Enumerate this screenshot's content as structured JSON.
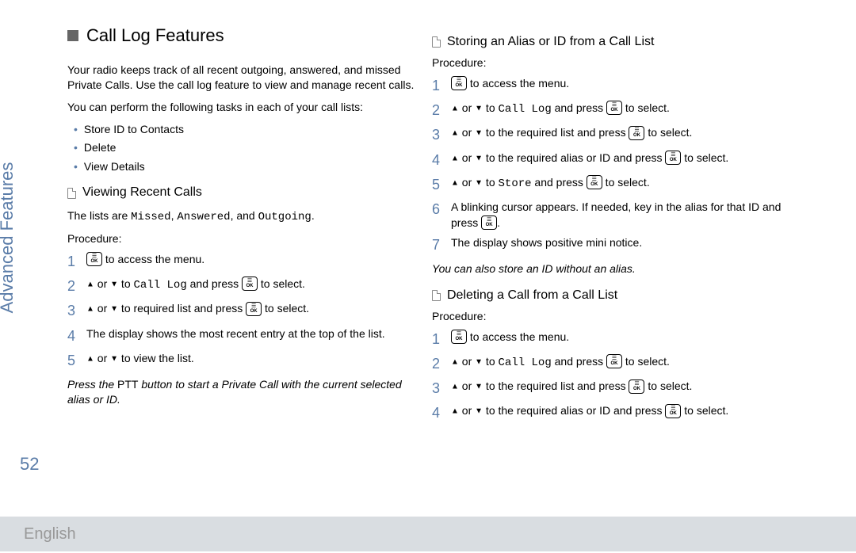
{
  "sideLabel": "Advanced Features",
  "pageNum": "52",
  "footerLang": "English",
  "title": "Call Log Features",
  "intro1": "Your radio keeps track of all recent outgoing, answered, and missed Private Calls. Use the call log feature to view and manage recent calls.",
  "intro2": "You can perform the following tasks in each of your call lists:",
  "bullets": [
    "Store ID to Contacts",
    "Delete",
    "View Details"
  ],
  "sec1": {
    "title": "Viewing Recent Calls",
    "intro_a": "The lists are ",
    "intro_m1": "Missed",
    "intro_s1": ", ",
    "intro_m2": "Answered",
    "intro_s2": ", and ",
    "intro_m3": "Outgoing",
    "intro_s3": ".",
    "proc": "Procedure:",
    "s1b": " to access the menu.",
    "s2a": " or ",
    "s2b": " to ",
    "s2m": "Call Log",
    "s2c": " and press ",
    "s2d": " to select.",
    "s3a": " or ",
    "s3b": " to required list and press ",
    "s3c": " to select.",
    "s4": "The display shows the most recent entry at the top of the list.",
    "s5a": " or ",
    "s5b": " to view the list.",
    "note_a": "Press the ",
    "note_b": "PTT",
    "note_c": " button to start a Private Call with the current selected alias or ID."
  },
  "sec2": {
    "title": "Storing an Alias or ID from a Call List",
    "proc": "Procedure:",
    "s1b": " to access the menu.",
    "s2a": " or ",
    "s2b": " to ",
    "s2m": "Call Log",
    "s2c": " and press ",
    "s2d": " to select.",
    "s3a": " or ",
    "s3b": " to the required list and press ",
    "s3c": " to select.",
    "s4a": " or ",
    "s4b": " to the required alias or ID and press ",
    "s4c": " to select.",
    "s5a": " or ",
    "s5b": " to ",
    "s5m": "Store",
    "s5c": " and press ",
    "s5d": " to select.",
    "s6a": "A blinking cursor appears. If needed, key in the alias for that ID and press ",
    "s6b": ".",
    "s7": "The display shows positive mini notice.",
    "note": "You can also store an ID without an alias."
  },
  "sec3": {
    "title": "Deleting a Call from a Call List",
    "proc": "Procedure:",
    "s1b": " to access the menu.",
    "s2a": " or ",
    "s2b": " to ",
    "s2m": "Call Log",
    "s2c": " and press ",
    "s2d": " to select.",
    "s3a": " or ",
    "s3b": " to the required list and press ",
    "s3c": " to select.",
    "s4a": " or ",
    "s4b": " to the required alias or ID and press ",
    "s4c": " to select."
  },
  "nums": {
    "1": "1",
    "2": "2",
    "3": "3",
    "4": "4",
    "5": "5",
    "6": "6",
    "7": "7"
  },
  "ok": {
    "top": "☰",
    "bot": "OK"
  },
  "arrows": {
    "up": "▲",
    "down": "▼"
  }
}
